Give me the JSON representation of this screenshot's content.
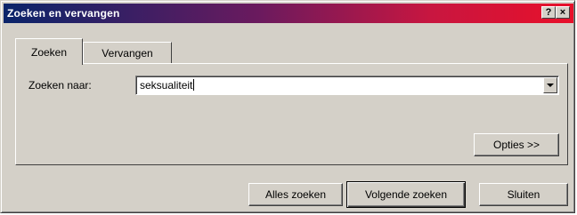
{
  "window": {
    "title": "Zoeken en vervangen",
    "help_label": "?",
    "close_label": "×"
  },
  "tabs": [
    {
      "label": "Zoeken",
      "active": true
    },
    {
      "label": "Vervangen",
      "active": false
    }
  ],
  "search": {
    "label": "Zoeken naar:",
    "value": "seksualiteit"
  },
  "buttons": {
    "options": "Opties >>",
    "find_all": "Alles zoeken",
    "find_next": "Volgende zoeken",
    "close": "Sluiten"
  },
  "colors": {
    "face": "#d4d0c8",
    "title_start": "#0a246a",
    "title_end": "#e8102a"
  }
}
